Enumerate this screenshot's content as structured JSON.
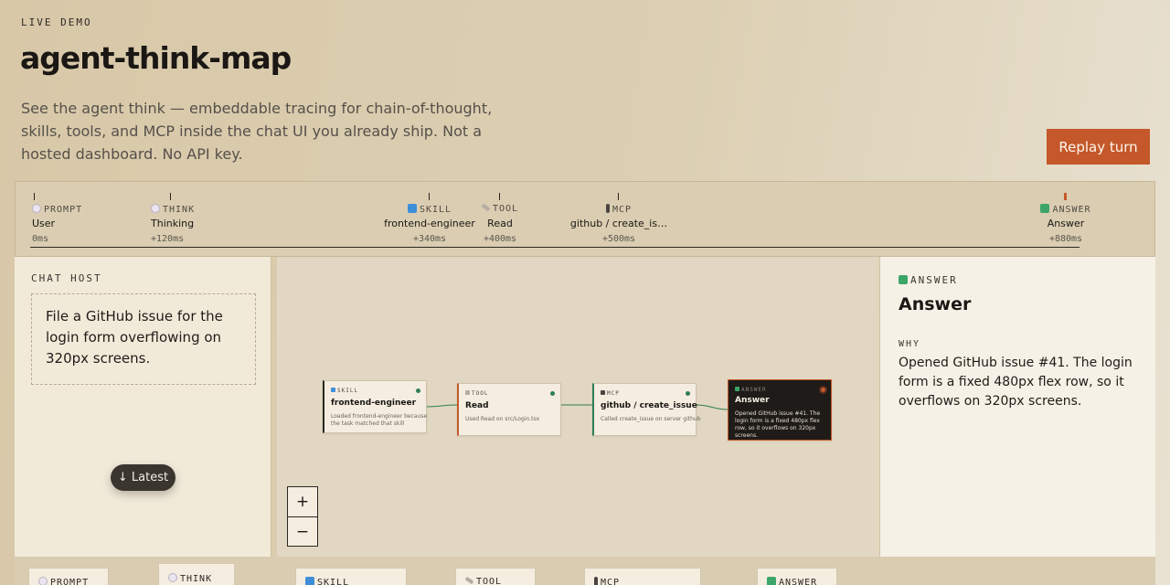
{
  "header": {
    "eyebrow": "LIVE DEMO",
    "title": "agent-think-map",
    "description": "See the agent think — embeddable tracing for chain-of-thought, skills, tools, and MCP inside the chat UI you already ship. Not a hosted dashboard. No API key.",
    "replay_label": "Replay turn"
  },
  "timeline": {
    "steps": [
      {
        "kind": "PROMPT",
        "icon": "speech-bubble-icon",
        "name": "User",
        "time": "0ms"
      },
      {
        "kind": "THINK",
        "icon": "thought-bubble-icon",
        "name": "Thinking",
        "time": "+120ms"
      },
      {
        "kind": "SKILL",
        "icon": "book-icon",
        "name": "frontend-engineer",
        "time": "+340ms"
      },
      {
        "kind": "TOOL",
        "icon": "wrench-icon",
        "name": "Read",
        "time": "+400ms"
      },
      {
        "kind": "MCP",
        "icon": "pin-icon",
        "name": "github / create_is…",
        "time": "+500ms"
      },
      {
        "kind": "ANSWER",
        "icon": "check-icon",
        "name": "Answer",
        "time": "+880ms"
      }
    ]
  },
  "chat": {
    "label": "CHAT HOST",
    "message": "File a GitHub issue for the login form overflowing on 320px screens.",
    "latest_label": "↓ Latest"
  },
  "graph": {
    "nodes": [
      {
        "kind": "SKILL",
        "icon": "book-icon",
        "title": "frontend-engineer",
        "desc": "Loaded frontend-engineer because the task matched that skill"
      },
      {
        "kind": "TOOL",
        "icon": "wrench-icon",
        "title": "Read",
        "desc": "Used Read on src/Login.tsx"
      },
      {
        "kind": "MCP",
        "icon": "pin-icon",
        "title": "github / create_issue",
        "desc": "Called create_issue on server github"
      },
      {
        "kind": "ANSWER",
        "icon": "check-icon",
        "title": "Answer",
        "desc": "Opened GitHub issue #41. The login form is a fixed 480px flex row, so it overflows on 320px screens."
      }
    ],
    "zoom_in": "+",
    "zoom_out": "−"
  },
  "detail": {
    "kind": "ANSWER",
    "icon": "check-icon",
    "title": "Answer",
    "why_label": "WHY",
    "body": "Opened GitHub issue #41. The login form is a fixed 480px flex row, so it overflows on 320px screens."
  },
  "bottom": {
    "cards": [
      {
        "kind": "PROMPT"
      },
      {
        "kind": "THINK"
      },
      {
        "kind": "SKILL"
      },
      {
        "kind": "TOOL"
      },
      {
        "kind": "MCP"
      },
      {
        "kind": "ANSWER"
      }
    ]
  },
  "colors": {
    "accent": "#c4582a",
    "success": "#2f7d55",
    "dark": "#1e1b18"
  }
}
